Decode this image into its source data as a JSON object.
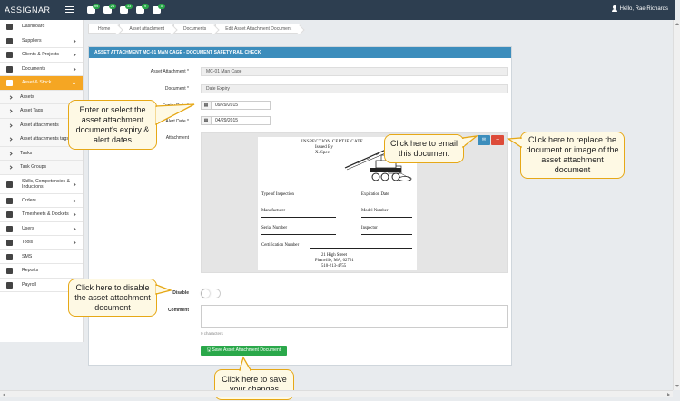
{
  "app": {
    "logo": "ASSIGNAR",
    "user_greeting": "Hello, Rae Richards"
  },
  "topbar": {
    "badges": [
      "99",
      "21",
      "33",
      "9",
      "0"
    ]
  },
  "sidebar": {
    "items": [
      {
        "label": "Dashboard",
        "icon": "dashboard-icon"
      },
      {
        "label": "Suppliers",
        "icon": "sitemap-icon"
      },
      {
        "label": "Clients & Projects",
        "icon": "briefcase-icon"
      },
      {
        "label": "Documents",
        "icon": "document-icon"
      },
      {
        "label": "Asset & Stock",
        "icon": "cubes-icon"
      }
    ],
    "subitems": [
      "Assets",
      "Asset Tags",
      "Asset attachments",
      "Asset attachments tags",
      "Tasks",
      "Task Groups"
    ],
    "items2": [
      {
        "label": "Skills, Competencies & Inductions",
        "icon": "graduation-cap-icon"
      },
      {
        "label": "Orders",
        "icon": "calendar-icon"
      },
      {
        "label": "Timesheets & Dockets",
        "icon": "table-icon"
      },
      {
        "label": "Users",
        "icon": "users-icon"
      },
      {
        "label": "Tools",
        "icon": "wrench-icon"
      },
      {
        "label": "SMS",
        "icon": "mobile-icon"
      },
      {
        "label": "Reports",
        "icon": "bar-chart-icon"
      },
      {
        "label": "Payroll",
        "icon": "money-icon"
      }
    ]
  },
  "breadcrumb": [
    "Home",
    "Asset attachment",
    "Documents",
    "Edit Asset Attachment Document"
  ],
  "panel": {
    "title": "ASSET ATTACHMENT MC-01 MAN CAGE - DOCUMENT SAFETY RAIL CHECK",
    "asset_attachment_label": "Asset Attachment *",
    "asset_attachment_value": "MC-01 Man Cage",
    "document_label": "Document *",
    "document_value": "Date Expiry",
    "expiry_label": "Expiry Date *",
    "expiry_value": "09/29/2015",
    "alert_label": "Alert Date *",
    "alert_value": "04/29/2015",
    "attachment_label": "Attachment",
    "mail_button": "✉",
    "delete_button": "−",
    "disable_label": "Disable",
    "comment_label": "Comment",
    "chars": "0 characters",
    "save_button": "Save Asset Attachment Document"
  },
  "certificate": {
    "title": "INSPECTION CERTIFICATE",
    "issued_by": "Issued By",
    "issuer": "X. Spec",
    "type_of_inspection": "Type of Inspection",
    "expiration_date": "Expiration Date",
    "manufacturer": "Manufacturer",
    "model_number": "Model Number",
    "serial_number": "Serial Number",
    "inspector": "Inspector",
    "certification_number": "Certification Number",
    "address1": "21 High Street",
    "address2": "Phanville, MA, 02761",
    "phone": "510-213-4755"
  },
  "callouts": {
    "dates": "Enter or select the asset attachment document's expiry & alert dates",
    "email": "Click here to email this document",
    "replace": "Click here to replace the document or image of the asset attachment document",
    "disable": "Click here to disable the asset attachment document",
    "save": "Click here to save your changes"
  },
  "colors": {
    "topbar": "#2d3e50",
    "accent": "#f5a623",
    "panel_head": "#3c8dbc",
    "save": "#2aa84a",
    "delete": "#dd4b39",
    "callout_border": "#e6a817"
  }
}
